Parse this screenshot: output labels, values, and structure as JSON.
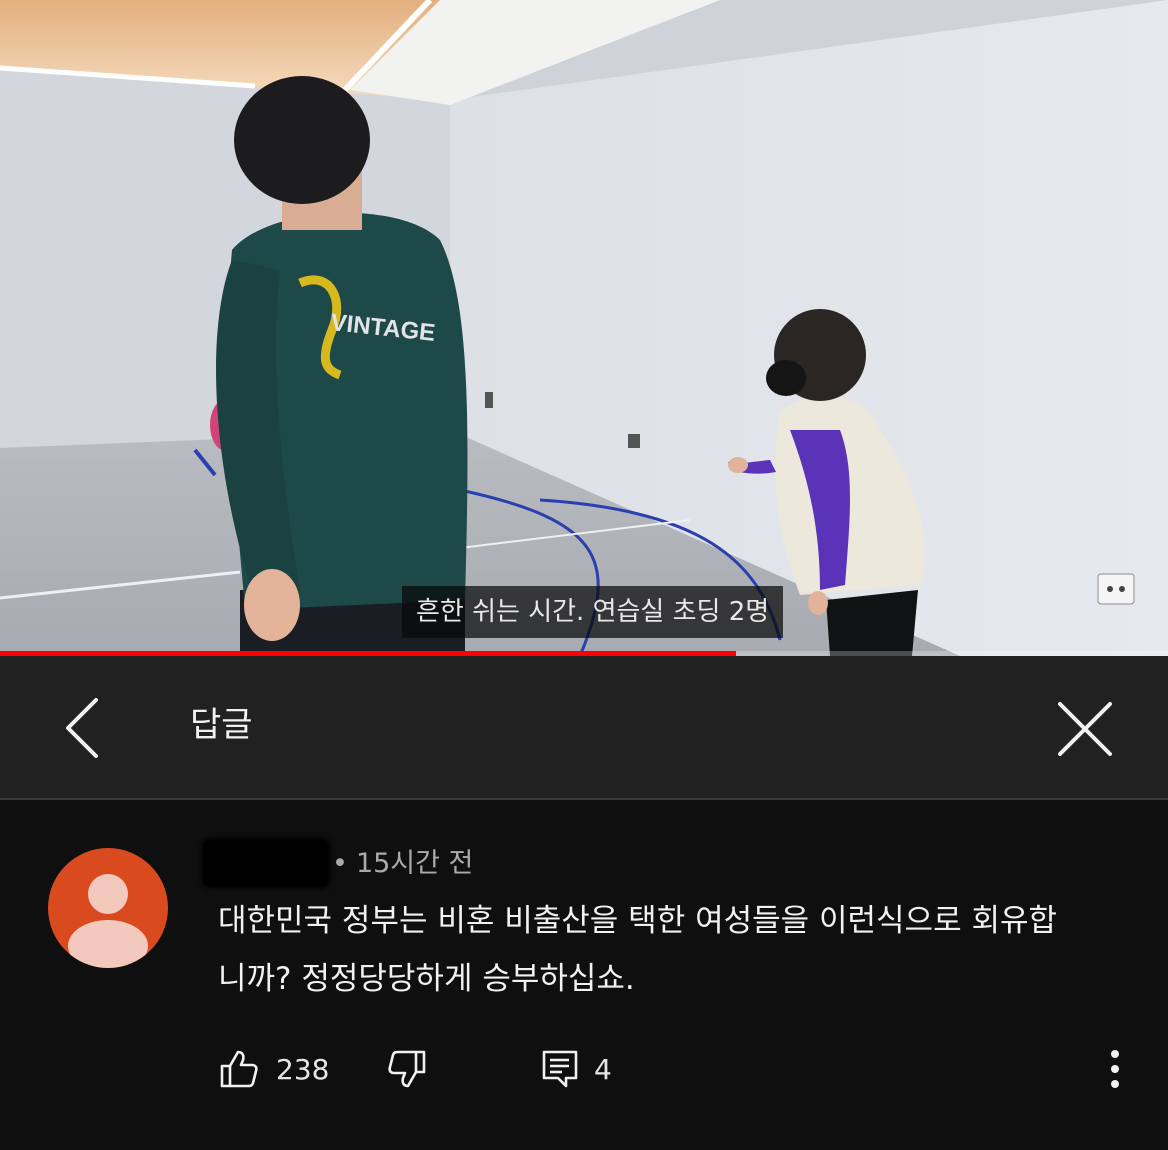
{
  "video": {
    "subtitle": "흔한 쉬는 시간. 연습실 초딩 2명",
    "progress_fraction": 0.63
  },
  "replies_panel": {
    "title": "답글",
    "back_icon": "chevron-left-icon",
    "close_icon": "close-icon"
  },
  "comment": {
    "time": "15시간 전",
    "text_lines": [
      "대한민국 정부는 비혼 비출산을 택한 여성들을 이런식으로 회유합",
      "니까? 정정당당하게 승부하십쇼."
    ],
    "avatar_color": "#d94a1e",
    "likes": "238",
    "replies": "4",
    "like_icon": "thumbs-up-icon",
    "dislike_icon": "thumbs-down-icon",
    "reply_icon": "reply-comment-icon",
    "more_icon": "more-vertical-icon"
  },
  "colors": {
    "background": "#0f0f0f",
    "header_bg": "#212121",
    "progress": "#ff0000",
    "text": "#f1f1f1",
    "secondary_text": "#aaaaaa"
  }
}
